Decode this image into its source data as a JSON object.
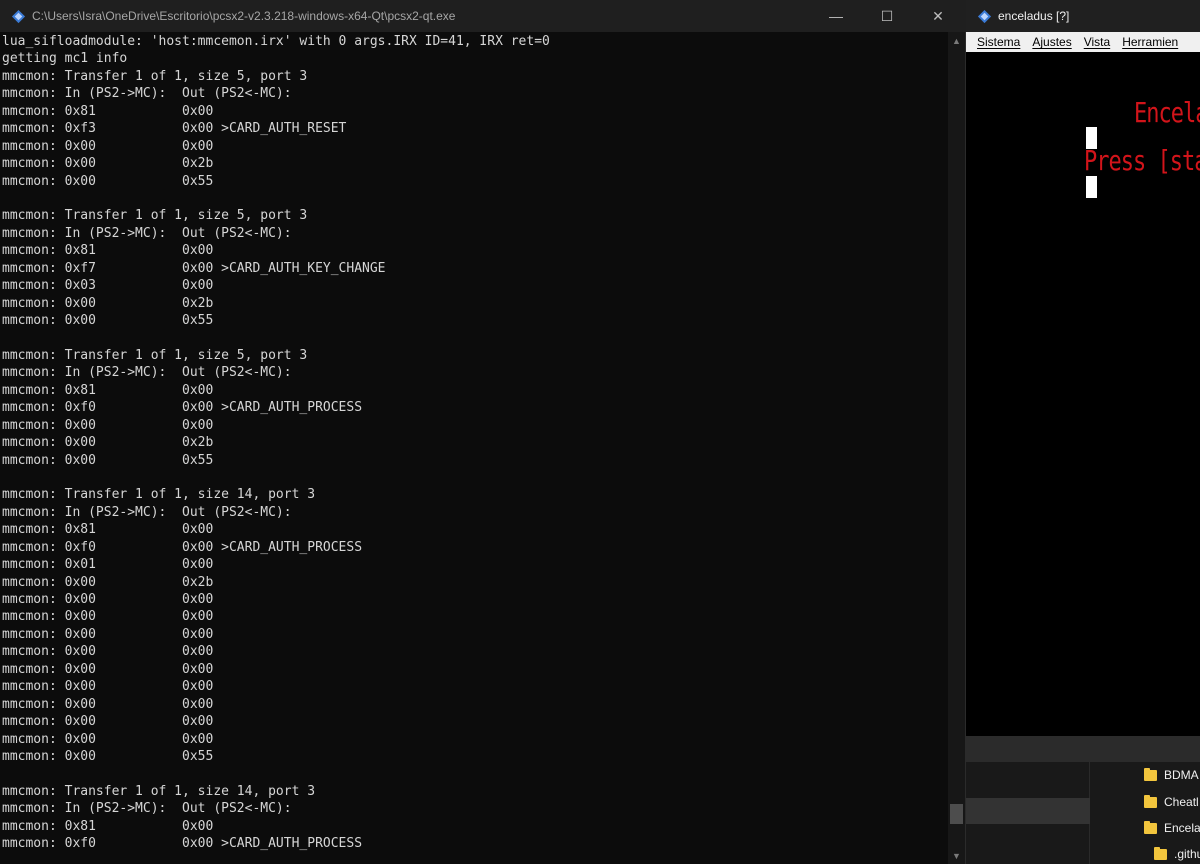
{
  "console": {
    "title": "C:\\Users\\Isra\\OneDrive\\Escritorio\\pcsx2-v2.3.218-windows-x64-Qt\\pcsx2-qt.exe",
    "lines": [
      "lua_sifloadmodule: 'host:mmcemon.irx' with 0 args.IRX ID=41, IRX ret=0",
      "getting mc1 info",
      "mmcmon: Transfer 1 of 1, size 5, port 3",
      "mmcmon: In (PS2->MC):  Out (PS2<-MC):",
      "mmcmon: 0x81           0x00",
      "mmcmon: 0xf3           0x00 >CARD_AUTH_RESET",
      "mmcmon: 0x00           0x00",
      "mmcmon: 0x00           0x2b",
      "mmcmon: 0x00           0x55",
      "",
      "mmcmon: Transfer 1 of 1, size 5, port 3",
      "mmcmon: In (PS2->MC):  Out (PS2<-MC):",
      "mmcmon: 0x81           0x00",
      "mmcmon: 0xf7           0x00 >CARD_AUTH_KEY_CHANGE",
      "mmcmon: 0x03           0x00",
      "mmcmon: 0x00           0x2b",
      "mmcmon: 0x00           0x55",
      "",
      "mmcmon: Transfer 1 of 1, size 5, port 3",
      "mmcmon: In (PS2->MC):  Out (PS2<-MC):",
      "mmcmon: 0x81           0x00",
      "mmcmon: 0xf0           0x00 >CARD_AUTH_PROCESS",
      "mmcmon: 0x00           0x00",
      "mmcmon: 0x00           0x2b",
      "mmcmon: 0x00           0x55",
      "",
      "mmcmon: Transfer 1 of 1, size 14, port 3",
      "mmcmon: In (PS2->MC):  Out (PS2<-MC):",
      "mmcmon: 0x81           0x00",
      "mmcmon: 0xf0           0x00 >CARD_AUTH_PROCESS",
      "mmcmon: 0x01           0x00",
      "mmcmon: 0x00           0x2b",
      "mmcmon: 0x00           0x00",
      "mmcmon: 0x00           0x00",
      "mmcmon: 0x00           0x00",
      "mmcmon: 0x00           0x00",
      "mmcmon: 0x00           0x00",
      "mmcmon: 0x00           0x00",
      "mmcmon: 0x00           0x00",
      "mmcmon: 0x00           0x00",
      "mmcmon: 0x00           0x00",
      "mmcmon: 0x00           0x55",
      "",
      "mmcmon: Transfer 1 of 1, size 14, port 3",
      "mmcmon: In (PS2->MC):  Out (PS2<-MC):",
      "mmcmon: 0x81           0x00",
      "mmcmon: 0xf0           0x00 >CARD_AUTH_PROCESS"
    ],
    "controls": {
      "minimize": "—",
      "maximize": "☐",
      "close": "✕"
    }
  },
  "enceladus": {
    "title": "enceladus [?]",
    "menu": [
      "Sistema",
      "Ajustes",
      "Vista",
      "Herramien"
    ],
    "screen_title": "Encelad",
    "screen_prompt": "Press [start"
  },
  "explorer": {
    "items": [
      "BDMA",
      "Cheatl",
      "Encela",
      ".githu"
    ]
  },
  "colors": {
    "console_bg": "#0c0c0c",
    "console_text": "#d6d6d6",
    "ps2_red": "#d2141a",
    "folder_yellow": "#f2c53d"
  }
}
